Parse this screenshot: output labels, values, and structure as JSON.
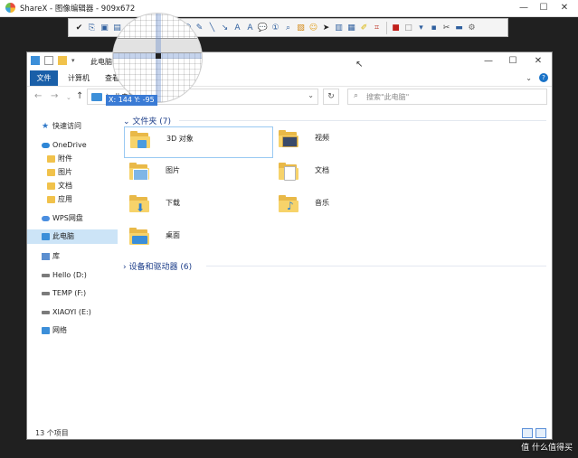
{
  "sharex": {
    "title": "ShareX - 图像编辑器 - 909x672",
    "controls": {
      "minimize": "—",
      "maximize": "☐",
      "close": "✕"
    }
  },
  "toolbar": {
    "icons": [
      "check-icon",
      "copy-icon",
      "save-icon",
      "save-as-icon",
      "upload-icon",
      "print-icon",
      "select-icon",
      "rectangle-icon",
      "ellipse-icon",
      "freehand-icon",
      "line-icon",
      "arrow-icon",
      "text-icon",
      "text-outline-icon",
      "speech-balloon-icon",
      "step-icon",
      "magnify-icon",
      "image-icon",
      "sticker-icon",
      "cursor-icon",
      "blur-icon",
      "pixelate-icon",
      "highlight-icon",
      "crop-icon",
      "border-color-icon",
      "fill-color-icon",
      "line-width-icon",
      "shadow-icon",
      "tools-icon",
      "edit-icon",
      "settings-icon"
    ]
  },
  "magnifier": {
    "coords": "X: 144 Y: -95"
  },
  "explorer": {
    "title": "此电脑",
    "ribbon": {
      "file": "文件",
      "computer": "计算机",
      "view": "查看",
      "help": "?"
    },
    "address": {
      "path": "此电脑"
    },
    "search": {
      "placeholder": "搜索\"此电脑\""
    },
    "sidebar": [
      {
        "label": "快速访问",
        "icon": "star-icon"
      },
      {
        "label": "OneDrive",
        "icon": "onedrive-icon"
      },
      {
        "label": "附件",
        "icon": "folder-icon"
      },
      {
        "label": "图片",
        "icon": "folder-icon"
      },
      {
        "label": "文档",
        "icon": "folder-icon"
      },
      {
        "label": "应用",
        "icon": "folder-icon"
      },
      {
        "label": "WPS网盘",
        "icon": "cloud-icon"
      },
      {
        "label": "此电脑",
        "icon": "computer-icon",
        "selected": true
      },
      {
        "label": "库",
        "icon": "library-icon"
      },
      {
        "label": "Hello (D:)",
        "icon": "drive-icon"
      },
      {
        "label": "TEMP (F:)",
        "icon": "drive-icon"
      },
      {
        "label": "XIAOYI (E:)",
        "icon": "drive-icon"
      },
      {
        "label": "网络",
        "icon": "network-icon"
      }
    ],
    "groups": {
      "folders": {
        "label": "文件夹 (7)"
      },
      "devices": {
        "label": "设备和驱动器 (6)"
      }
    },
    "folders": [
      {
        "label": "3D 对象",
        "icon": "3d-objects-icon"
      },
      {
        "label": "视频",
        "icon": "videos-icon"
      },
      {
        "label": "图片",
        "icon": "pictures-icon"
      },
      {
        "label": "文档",
        "icon": "documents-icon"
      },
      {
        "label": "下载",
        "icon": "downloads-icon"
      },
      {
        "label": "音乐",
        "icon": "music-icon"
      },
      {
        "label": "桌面",
        "icon": "desktop-icon"
      }
    ],
    "status": {
      "count": "13 个项目"
    }
  },
  "watermark": {
    "text": "值 什么值得买"
  }
}
